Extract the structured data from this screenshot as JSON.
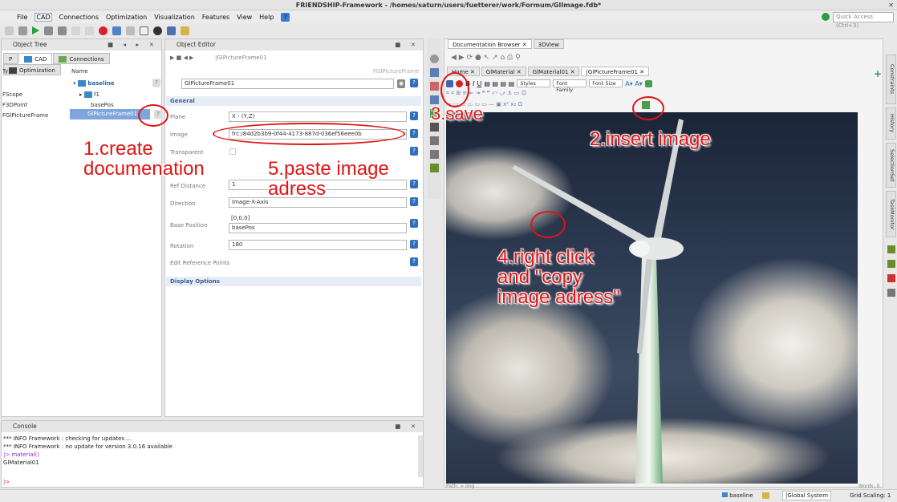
{
  "window": {
    "title": "FRIENDSHIP-Framework - /homes/saturn/users/fuetterer/work/Formum/GlImage.fdb*",
    "close": "✕"
  },
  "menu": [
    "File",
    "CAD",
    "Connections",
    "Optimization",
    "Visualization",
    "Features",
    "View",
    "Help"
  ],
  "quick_access": "Quick Access (Ctrl+3)",
  "object_tree": {
    "title": "Object Tree",
    "tabs": [
      "P",
      "CAD",
      "Connections",
      "Optimization"
    ],
    "col_type": "Type",
    "col_name": "Name",
    "types": [
      "FScope",
      "F3DPoint",
      "FGlPictureFrame"
    ],
    "names": [
      "baseline",
      "f1",
      "basePos",
      "GlPictureFrame01"
    ]
  },
  "object_editor": {
    "title": "Object Editor",
    "breadcrumb": "|GlPictureFrame01",
    "type_label": "FGlPictureFrame",
    "name_value": "GlPictureFrame01",
    "general": "General",
    "plane_label": "Plane",
    "plane_value": "X - (Y,Z)",
    "image_label": "Image",
    "image_value": "frc:/84d2b3b9-0f44-4173-887d-036ef56eee0b",
    "transparent_label": "Transparent",
    "refdist_label": "Ref Distance",
    "refdist_value": "1",
    "direction_label": "Direction",
    "direction_value": "Image-X-Axis",
    "basepos_label": "Base Position",
    "basepos_coords": "[0,0,0]",
    "basepos_value": "basePos",
    "rotation_label": "Rotation",
    "rotation_value": "180",
    "editref_label": "Edit Reference Points",
    "display_options": "Display Options"
  },
  "browser": {
    "tabs": [
      "Documentation Browser",
      "3DView"
    ],
    "doc_tabs": [
      "Home",
      "GlMaterial",
      "GlMaterial01",
      "|GlPictureFrame01"
    ],
    "styles": "Styles",
    "font_family": "Font Family",
    "font_size": "Font Size",
    "path_hint": "Path: > img",
    "words": "Words: 0"
  },
  "side_tabs": [
    "Constraints",
    "History",
    "SelectionSet",
    "TaskMonitor"
  ],
  "console": {
    "title": "Console",
    "lines": [
      "*** INFO Framework : checking for updates ...",
      "*** INFO Framework : no update for version 3.0.16 available",
      "|> material()",
      "GlMaterial01"
    ],
    "prompt": "|>"
  },
  "status": {
    "baseline": "baseline",
    "global": "|Global System",
    "grid": "Grid Scaling: 1"
  },
  "annotations": {
    "a1": "1.create\ndocumenation",
    "a2": "2.insert image",
    "a3": "3.save",
    "a4": "4.right click\nand \"copy\nimage adress\"",
    "a5": "5.paste image\nadress"
  },
  "colors": {
    "annotation": "#e11414",
    "accent": "#2f6fc0",
    "selection": "#7ea6dc"
  }
}
